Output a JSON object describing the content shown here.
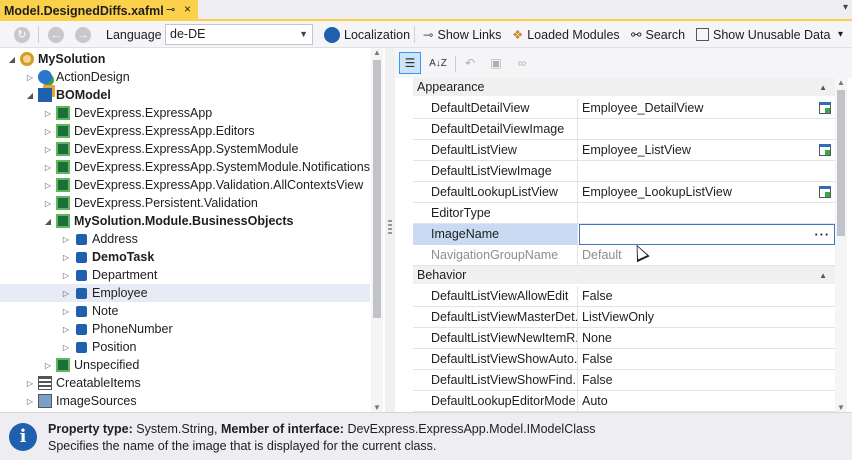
{
  "document_tab": {
    "title": "Model.DesignedDiffs.xafml",
    "pin_icon": "pin-icon",
    "close_label": "×"
  },
  "toolbar": {
    "language_label": "Language",
    "language_value": "de-DE",
    "localization_label": "Localization",
    "show_links_label": "Show Links",
    "loaded_modules_label": "Loaded Modules",
    "search_label": "Search",
    "show_unusable_label": "Show Unusable Data"
  },
  "tree": {
    "items": [
      {
        "label": "MySolution",
        "level": 0,
        "expanded": true,
        "bold": true,
        "icon": "solution-icon"
      },
      {
        "label": "ActionDesign",
        "level": 1,
        "expanded": false,
        "bold": false,
        "icon": "action-design-icon"
      },
      {
        "label": "BOModel",
        "level": 1,
        "expanded": true,
        "bold": true,
        "icon": "bo-model-icon"
      },
      {
        "label": "DevExpress.ExpressApp",
        "level": 2,
        "expanded": false,
        "bold": false,
        "icon": "namespace-icon"
      },
      {
        "label": "DevExpress.ExpressApp.Editors",
        "level": 2,
        "expanded": false,
        "bold": false,
        "icon": "namespace-icon"
      },
      {
        "label": "DevExpress.ExpressApp.SystemModule",
        "level": 2,
        "expanded": false,
        "bold": false,
        "icon": "namespace-icon"
      },
      {
        "label": "DevExpress.ExpressApp.SystemModule.Notifications",
        "level": 2,
        "expanded": false,
        "bold": false,
        "icon": "namespace-icon"
      },
      {
        "label": "DevExpress.ExpressApp.Validation.AllContextsView",
        "level": 2,
        "expanded": false,
        "bold": false,
        "icon": "namespace-icon"
      },
      {
        "label": "DevExpress.Persistent.Validation",
        "level": 2,
        "expanded": false,
        "bold": false,
        "icon": "namespace-icon"
      },
      {
        "label": "MySolution.Module.BusinessObjects",
        "level": 2,
        "expanded": true,
        "bold": true,
        "icon": "namespace-icon"
      },
      {
        "label": "Address",
        "level": 3,
        "expanded": false,
        "bold": false,
        "icon": "class-icon"
      },
      {
        "label": "DemoTask",
        "level": 3,
        "expanded": false,
        "bold": true,
        "icon": "class-icon"
      },
      {
        "label": "Department",
        "level": 3,
        "expanded": false,
        "bold": false,
        "icon": "class-icon"
      },
      {
        "label": "Employee",
        "level": 3,
        "expanded": false,
        "bold": false,
        "icon": "class-icon",
        "selected": true
      },
      {
        "label": "Note",
        "level": 3,
        "expanded": false,
        "bold": false,
        "icon": "class-icon"
      },
      {
        "label": "PhoneNumber",
        "level": 3,
        "expanded": false,
        "bold": false,
        "icon": "class-icon"
      },
      {
        "label": "Position",
        "level": 3,
        "expanded": false,
        "bold": false,
        "icon": "class-icon"
      },
      {
        "label": "Unspecified",
        "level": 2,
        "expanded": false,
        "bold": false,
        "icon": "namespace-icon"
      },
      {
        "label": "CreatableItems",
        "level": 1,
        "expanded": false,
        "bold": false,
        "icon": "creatable-items-icon"
      },
      {
        "label": "ImageSources",
        "level": 1,
        "expanded": false,
        "bold": false,
        "icon": "image-sources-icon"
      }
    ]
  },
  "property_grid": {
    "categories": [
      {
        "name": "Appearance",
        "rows": [
          {
            "name": "DefaultDetailView",
            "value": "Employee_DetailView",
            "button": "view-editor-icon"
          },
          {
            "name": "DefaultDetailViewImage",
            "value": "",
            "button": ""
          },
          {
            "name": "DefaultListView",
            "value": "Employee_ListView",
            "button": "view-editor-icon"
          },
          {
            "name": "DefaultListViewImage",
            "value": "",
            "button": ""
          },
          {
            "name": "DefaultLookupListView",
            "value": "Employee_LookupListView",
            "button": "view-editor-icon"
          },
          {
            "name": "EditorType",
            "value": "",
            "button": ""
          },
          {
            "name": "ImageName",
            "value": "",
            "button": "ellipsis",
            "selected": true
          },
          {
            "name": "NavigationGroupName",
            "value": "Default",
            "button": "",
            "disabled": true
          }
        ]
      },
      {
        "name": "Behavior",
        "rows": [
          {
            "name": "DefaultListViewAllowEdit",
            "value": "False",
            "button": ""
          },
          {
            "name": "DefaultListViewMasterDet...",
            "value": "ListViewOnly",
            "button": ""
          },
          {
            "name": "DefaultListViewNewItemR...",
            "value": "None",
            "button": ""
          },
          {
            "name": "DefaultListViewShowAuto...",
            "value": "False",
            "button": ""
          },
          {
            "name": "DefaultListViewShowFind...",
            "value": "False",
            "button": ""
          },
          {
            "name": "DefaultLookupEditorMode",
            "value": "Auto",
            "button": ""
          }
        ]
      }
    ],
    "ellipsis_label": "···"
  },
  "description": {
    "type_label": "Property type:",
    "type_value": "System.String,",
    "member_label": "Member of interface:",
    "member_value": "DevExpress.ExpressApp.Model.IModelClass",
    "text": "Specifies the name of the image that is displayed for the current class."
  },
  "colors": {
    "accent_tab": "#fbd14b",
    "selection": "#c9daf2",
    "info": "#1e5fae"
  }
}
